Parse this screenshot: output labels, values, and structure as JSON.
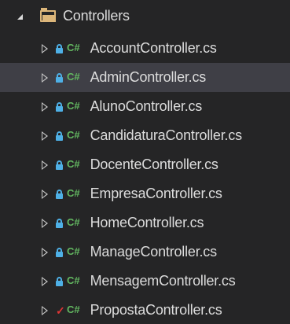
{
  "folder": {
    "name": "Controllers"
  },
  "files": [
    {
      "name": "AccountController.cs",
      "status": "lock",
      "selected": false
    },
    {
      "name": "AdminController.cs",
      "status": "lock",
      "selected": true
    },
    {
      "name": "AlunoController.cs",
      "status": "lock",
      "selected": false
    },
    {
      "name": "CandidaturaController.cs",
      "status": "lock",
      "selected": false
    },
    {
      "name": "DocenteController.cs",
      "status": "lock",
      "selected": false
    },
    {
      "name": "EmpresaController.cs",
      "status": "lock",
      "selected": false
    },
    {
      "name": "HomeController.cs",
      "status": "lock",
      "selected": false
    },
    {
      "name": "ManageController.cs",
      "status": "lock",
      "selected": false
    },
    {
      "name": "MensagemController.cs",
      "status": "lock",
      "selected": false
    },
    {
      "name": "PropostaController.cs",
      "status": "checkmark",
      "selected": false
    }
  ],
  "icons": {
    "csharp": "C#",
    "checkmark": "✓"
  },
  "colors": {
    "background": "#252526",
    "selected_row": "#3f3f46",
    "text": "#dcdcdc",
    "folder": "#dcb67a",
    "lock": "#4eb0e6",
    "csharp": "#63b861",
    "checkmark": "#e03535"
  }
}
